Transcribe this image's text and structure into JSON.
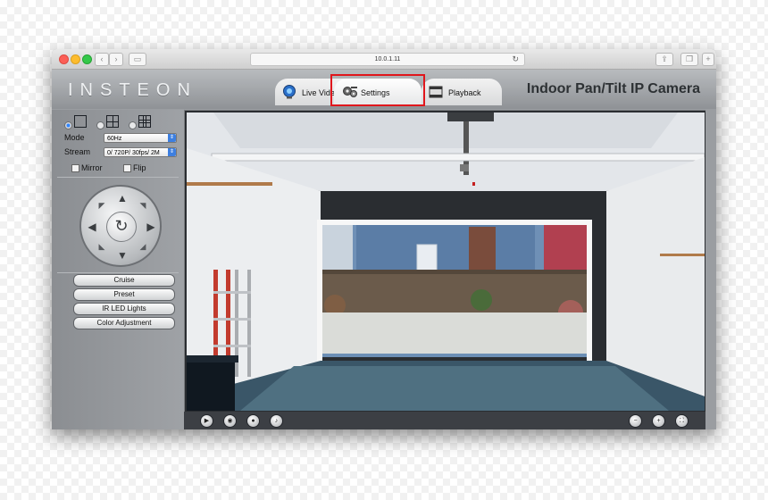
{
  "browser": {
    "url": "10.0.1.11"
  },
  "header": {
    "logo": "INSTEON",
    "camera_title": "Indoor Pan/Tilt IP Camera",
    "tabs": [
      {
        "label": "Live Video",
        "icon": "camera-lens-icon"
      },
      {
        "label": "Settings",
        "icon": "gears-icon",
        "active": true
      },
      {
        "label": "Playback",
        "icon": "film-icon"
      }
    ],
    "highlight_color": "#e0161c"
  },
  "controls": {
    "mode_label": "Mode",
    "mode_value": "60Hz",
    "stream_label": "Stream",
    "stream_value": "0/ 720P/ 30fps/ 2M",
    "mirror_label": "Mirror",
    "flip_label": "Flip",
    "buttons": [
      "Cruise",
      "Preset",
      "IR LED Lights",
      "Color Adjustment"
    ]
  },
  "colors": {
    "accent": "#3d7fe0",
    "panel": "#9a9da1"
  }
}
